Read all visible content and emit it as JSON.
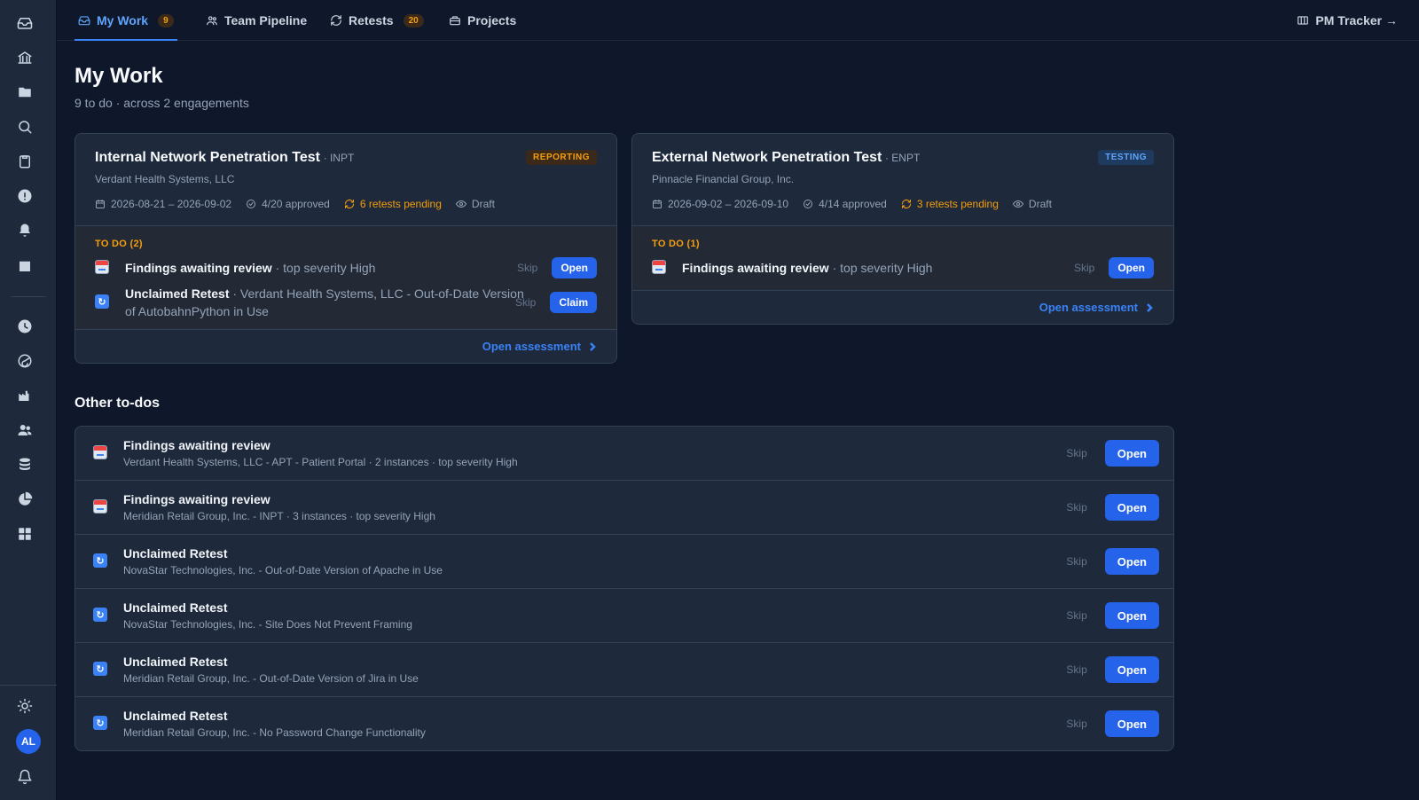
{
  "nav": {
    "tabs": [
      {
        "label": "My Work",
        "badge": "9"
      },
      {
        "label": "Team Pipeline"
      },
      {
        "label": "Retests",
        "badge": "20"
      },
      {
        "label": "Projects"
      }
    ],
    "pm_tracker": "PM Tracker →"
  },
  "user": {
    "initials": "AL"
  },
  "header": {
    "title": "My Work",
    "subtitle": "9 to do · across 2 engagements"
  },
  "engagements": [
    {
      "title": "Internal Network Penetration Test",
      "code": "· INPT",
      "client": "Verdant Health Systems, LLC",
      "status": "REPORTING",
      "dates": "2026-08-21 – 2026-09-02",
      "approved": "4/20 approved",
      "retests": "6 retests pending",
      "draft": "Draft",
      "todo_label": "TO DO (2)",
      "todos": [
        {
          "title": "Findings awaiting review",
          "detail": " · top severity High",
          "skip": "Skip",
          "action": "Open"
        },
        {
          "title": "Unclaimed Retest",
          "detail": " · Verdant Health Systems, LLC - Out-of-Date Version of AutobahnPython in Use",
          "skip": "Skip",
          "action": "Claim"
        }
      ],
      "footer": "Open assessment"
    },
    {
      "title": "External Network Penetration Test",
      "code": "· ENPT",
      "client": "Pinnacle Financial Group, Inc.",
      "status": "TESTING",
      "dates": "2026-09-02 – 2026-09-10",
      "approved": "4/14 approved",
      "retests": "3 retests pending",
      "draft": "Draft",
      "todo_label": "TO DO (1)",
      "todos": [
        {
          "title": "Findings awaiting review",
          "detail": " · top severity High",
          "skip": "Skip",
          "action": "Open"
        }
      ],
      "footer": "Open assessment"
    }
  ],
  "other": {
    "title": "Other to-dos",
    "items": [
      {
        "type": "finding",
        "title": "Findings awaiting review",
        "detail": "Verdant Health Systems, LLC - APT - Patient Portal · 2 instances · top severity High",
        "skip": "Skip",
        "action": "Open"
      },
      {
        "type": "finding",
        "title": "Findings awaiting review",
        "detail": "Meridian Retail Group, Inc. - INPT · 3 instances · top severity High",
        "skip": "Skip",
        "action": "Open"
      },
      {
        "type": "retest",
        "title": "Unclaimed Retest",
        "detail": "NovaStar Technologies, Inc. - Out-of-Date Version of Apache in Use",
        "skip": "Skip",
        "action": "Open"
      },
      {
        "type": "retest",
        "title": "Unclaimed Retest",
        "detail": "NovaStar Technologies, Inc. - Site Does Not Prevent Framing",
        "skip": "Skip",
        "action": "Open"
      },
      {
        "type": "retest",
        "title": "Unclaimed Retest",
        "detail": "Meridian Retail Group, Inc. - Out-of-Date Version of Jira in Use",
        "skip": "Skip",
        "action": "Open"
      },
      {
        "type": "retest",
        "title": "Unclaimed Retest",
        "detail": "Meridian Retail Group, Inc. - No Password Change Functionality",
        "skip": "Skip",
        "action": "Open"
      }
    ]
  },
  "colors": {
    "accent": "#2563eb",
    "warning": "#f59e0b",
    "background": "#0f172a",
    "card": "#1e293b"
  }
}
